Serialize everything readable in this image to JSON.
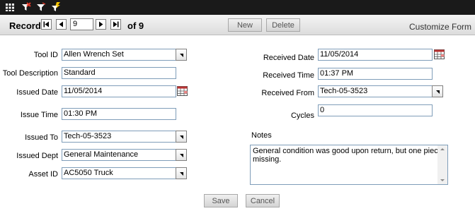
{
  "toolbar": {
    "icons": [
      "grid-icon",
      "filter-remove-icon",
      "filter-icon",
      "filter-apply-icon"
    ]
  },
  "navigation": {
    "record_label": "Record:",
    "current_record": "9",
    "of_label": "of 9",
    "new_label": "New",
    "delete_label": "Delete",
    "customize_label": "Customize Form"
  },
  "form": {
    "tool_id": {
      "label": "Tool ID",
      "value": "Allen Wrench Set"
    },
    "tool_description": {
      "label": "Tool Description",
      "value": "Standard"
    },
    "issued_date": {
      "label": "Issued Date",
      "value": "11/05/2014"
    },
    "issue_time": {
      "label": "Issue Time",
      "value": "01:30 PM"
    },
    "issued_to": {
      "label": "Issued To",
      "value": "Tech-05-3523"
    },
    "issued_dept": {
      "label": "Issued Dept",
      "value": "General Maintenance"
    },
    "asset_id": {
      "label": "Asset ID",
      "value": "AC5050 Truck"
    },
    "received_date": {
      "label": "Received Date",
      "value": "11/05/2014"
    },
    "received_time": {
      "label": "Received Time",
      "value": "01:37 PM"
    },
    "received_from": {
      "label": "Received From",
      "value": "Tech-05-3523"
    },
    "cycles": {
      "label": "Cycles",
      "value": "0"
    },
    "notes": {
      "label": "Notes",
      "value": "General condition was good upon return, but one piece missing."
    }
  },
  "actions": {
    "save_label": "Save",
    "cancel_label": "Cancel"
  },
  "colors": {
    "topbar": "#1a1a1a",
    "field_border": "#7f9db9"
  }
}
